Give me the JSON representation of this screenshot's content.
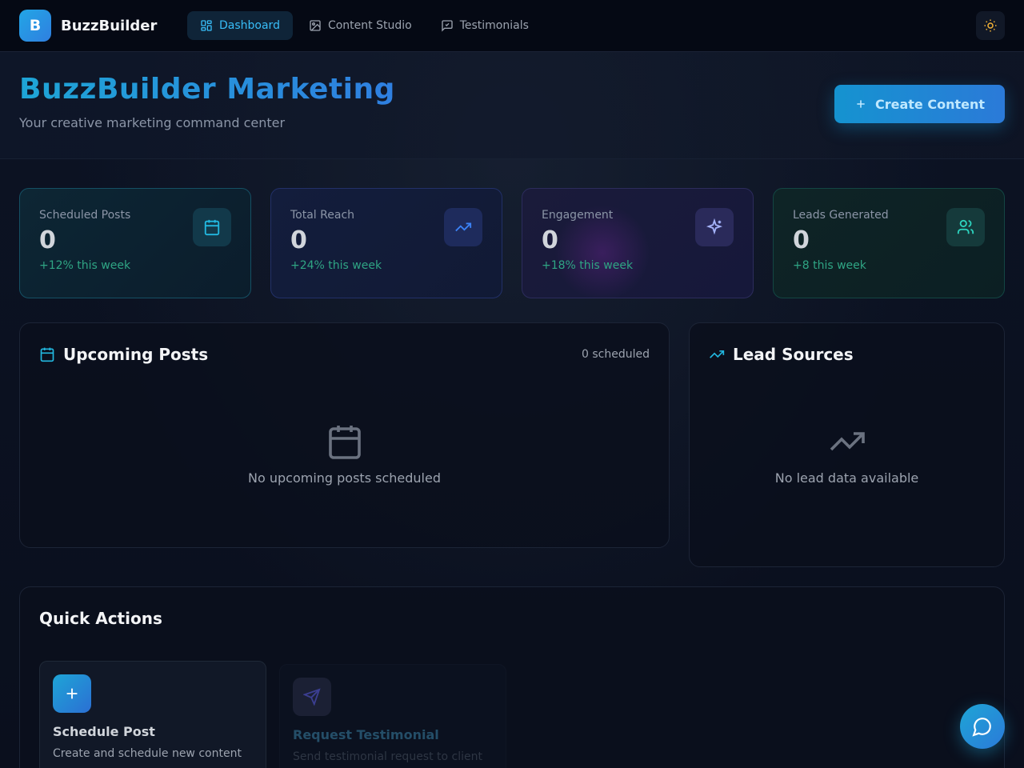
{
  "app": {
    "logo_letter": "B",
    "name": "BuzzBuilder"
  },
  "nav": {
    "tabs": [
      {
        "label": "Dashboard",
        "icon": "dashboard-icon",
        "active": true
      },
      {
        "label": "Content Studio",
        "icon": "image-icon",
        "active": false
      },
      {
        "label": "Testimonials",
        "icon": "message-square-icon",
        "active": false
      }
    ],
    "theme_icon": "sun-icon"
  },
  "header": {
    "title": "BuzzBuilder Marketing",
    "subtitle": "Your creative marketing command center",
    "create_label": "Create Content"
  },
  "stats": [
    {
      "label": "Scheduled Posts",
      "value": "0",
      "change": "+12% this week",
      "icon": "calendar-icon"
    },
    {
      "label": "Total Reach",
      "value": "0",
      "change": "+24% this week",
      "icon": "trending-up-icon"
    },
    {
      "label": "Engagement",
      "value": "0",
      "change": "+18% this week",
      "icon": "sparkles-icon"
    },
    {
      "label": "Leads Generated",
      "value": "0",
      "change": "+8 this week",
      "icon": "users-icon"
    }
  ],
  "upcoming": {
    "title": "Upcoming Posts",
    "count_label": "0 scheduled",
    "empty_text": "No upcoming posts scheduled"
  },
  "leads": {
    "title": "Lead Sources",
    "empty_text": "No lead data available"
  },
  "quick_actions": {
    "title": "Quick Actions",
    "items": [
      {
        "name": "Schedule Post",
        "desc": "Create and schedule new content",
        "icon": "plus-icon"
      },
      {
        "name": "Request Testimonial",
        "desc": "Send testimonial request to client",
        "icon": "send-icon"
      }
    ]
  },
  "colors": {
    "accent": "#1ea5d6",
    "accent_blue": "#2f7fe0",
    "positive": "#2fa584",
    "background": "#0b1120"
  }
}
